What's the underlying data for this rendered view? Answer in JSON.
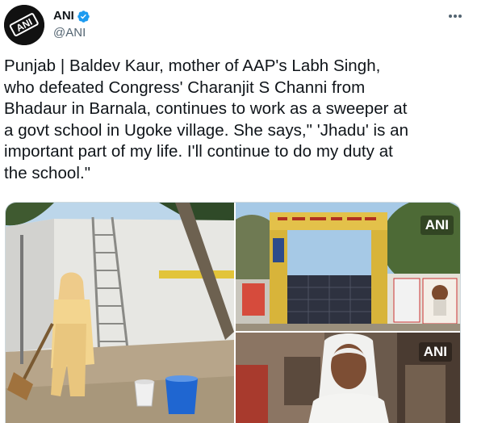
{
  "account": {
    "display_name": "ANI",
    "handle": "@ANI",
    "verified": true,
    "avatar_icon": "ani-logo",
    "avatar_text": "ANI"
  },
  "tweet": {
    "lines": [
      "Punjab | Baldev Kaur, mother of AAP's Labh Singh,",
      "who defeated Congress' Charanjit S Channi from",
      "Bhadaur in Barnala, continues to work as a sweeper at",
      "a govt school in Ugoke village. She says,\" 'Jhadu' is an",
      "important part of my life. I'll continue to do my duty at",
      "the school.\""
    ]
  },
  "media": {
    "photo_2_watermark": "ANI",
    "photo_3_watermark": "ANI"
  },
  "icons": {
    "verified": "verified-badge-icon",
    "more": "more-options-icon"
  },
  "colors": {
    "verified_blue": "#1d9bf0",
    "text_primary": "#0f1419",
    "text_secondary": "#536471"
  }
}
